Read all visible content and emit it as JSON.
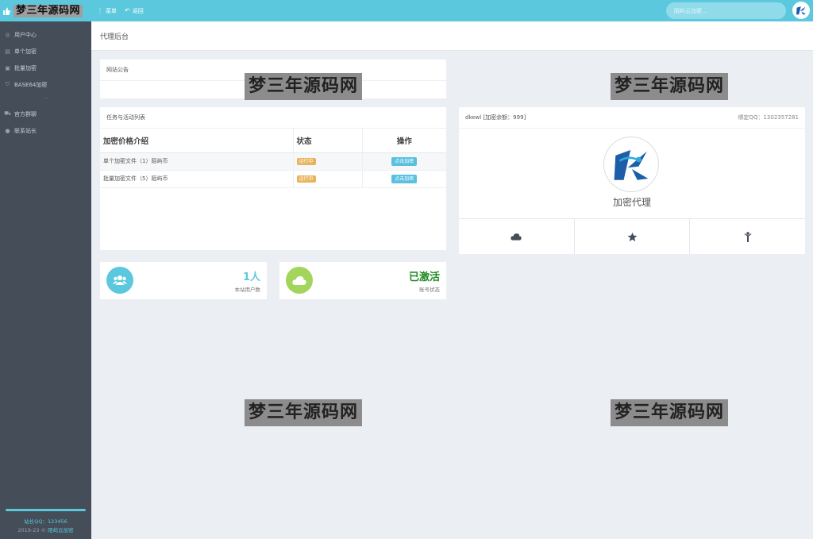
{
  "logo": {
    "text": "梦三年源码网"
  },
  "topnav": {
    "menu_label": "菜单",
    "back_label": "返回"
  },
  "search": {
    "placeholder": "陌屿云加密..."
  },
  "sidebar": {
    "items": [
      {
        "label": "用户中心",
        "icon": "user-circle-icon"
      },
      {
        "label": "单个加密",
        "icon": "file-icon"
      },
      {
        "label": "批量加密",
        "icon": "stack-icon"
      },
      {
        "label": "BASE64加密",
        "icon": "shield-icon"
      }
    ],
    "sep": "...",
    "items2": [
      {
        "label": "官方群聊",
        "icon": "cart-icon"
      },
      {
        "label": "联系站长",
        "icon": "chat-icon"
      }
    ],
    "footer_qq": "站长QQ：123456",
    "footer_copy_prefix": "2019-23 ©",
    "footer_copy_link": "陌屿云加密"
  },
  "page": {
    "title": "代理后台"
  },
  "notice": {
    "title": "网站公告"
  },
  "tasks": {
    "title": "任务与活动列表",
    "headers": [
      "加密价格介绍",
      "状态",
      "操作"
    ],
    "rows": [
      {
        "desc": "单个加密文件（1）陌屿币",
        "status": "运行中",
        "action": "点击加密"
      },
      {
        "desc": "批量加密文件（5）陌屿币",
        "status": "运行中",
        "action": "点击加密"
      }
    ]
  },
  "stats": [
    {
      "value": "1人",
      "label": "本站用户数",
      "color": "#5bc8de",
      "value_color": "#5bc8de",
      "icon": "users-icon"
    },
    {
      "value": "已激活",
      "label": "账号状态",
      "color": "#a3d55d",
      "value_color": "#1e8a1e",
      "icon": "cloud-icon"
    }
  ],
  "profile": {
    "user": "dkewl [加密余额：999]",
    "qq": "绑定QQ：1302357281",
    "role": "加密代理",
    "actions": [
      {
        "icon": "cloud-icon"
      },
      {
        "icon": "star-icon"
      },
      {
        "icon": "person-icon"
      }
    ]
  },
  "watermark": "梦三年源码网",
  "colors": {
    "accent": "#5bc8de",
    "sidebar": "#444d58",
    "badge": "#e8b35a"
  }
}
